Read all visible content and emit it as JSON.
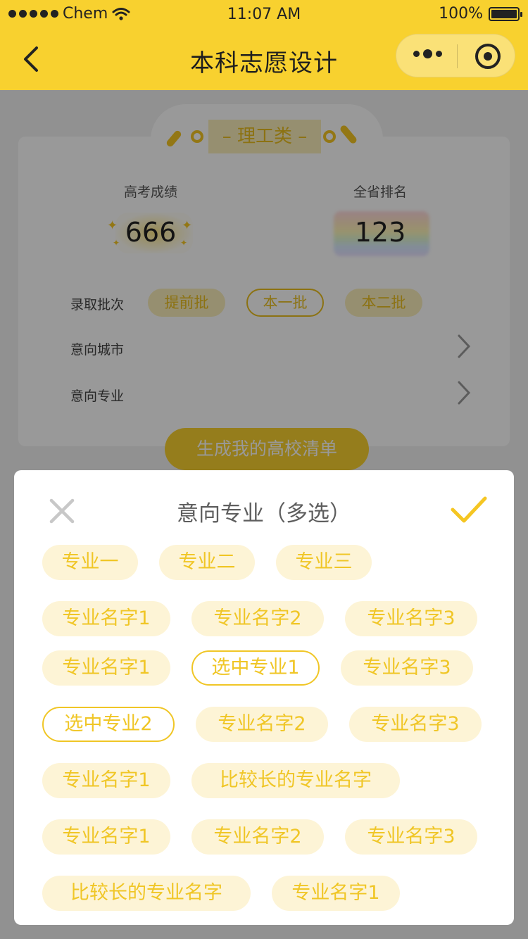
{
  "status_bar": {
    "carrier": "Chem",
    "time": "11:07 AM",
    "battery": "100%"
  },
  "nav": {
    "title": "本科志愿设计"
  },
  "card": {
    "category_title": "– 理工类 –",
    "score_label": "高考成绩",
    "score_value": "666",
    "rank_label": "全省排名",
    "rank_value": "123",
    "batch_label": "录取批次",
    "batches": [
      {
        "label": "提前批",
        "selected": false
      },
      {
        "label": "本一批",
        "selected": true
      },
      {
        "label": "本二批",
        "selected": false
      }
    ],
    "city_label": "意向城市",
    "major_label": "意向专业",
    "generate_label": "生成我的高校清单"
  },
  "sheet": {
    "title": "意向专业（多选）",
    "tags": [
      {
        "label": "专业一",
        "selected": false
      },
      {
        "label": "专业二",
        "selected": false
      },
      {
        "label": "专业三",
        "selected": false
      },
      {
        "label": "专业名字1",
        "selected": false
      },
      {
        "label": "专业名字2",
        "selected": false
      },
      {
        "label": "专业名字3",
        "selected": false
      },
      {
        "label": "专业名字1",
        "selected": false
      },
      {
        "label": "选中专业1",
        "selected": true
      },
      {
        "label": "专业名字3",
        "selected": false
      },
      {
        "label": "选中专业2",
        "selected": true
      },
      {
        "label": "专业名字2",
        "selected": false
      },
      {
        "label": "专业名字3",
        "selected": false
      },
      {
        "label": "专业名字1",
        "selected": false
      },
      {
        "label": "比较长的专业名字",
        "selected": false
      },
      {
        "label": "专业名字1",
        "selected": false
      },
      {
        "label": "专业名字2",
        "selected": false
      },
      {
        "label": "专业名字3",
        "selected": false
      },
      {
        "label": "比较长的专业名字",
        "selected": false
      },
      {
        "label": "专业名字1",
        "selected": false
      }
    ]
  },
  "colors": {
    "brand_yellow": "#f8d12f",
    "tag_text": "#f0c626",
    "tag_bg": "#fdf4d6"
  }
}
